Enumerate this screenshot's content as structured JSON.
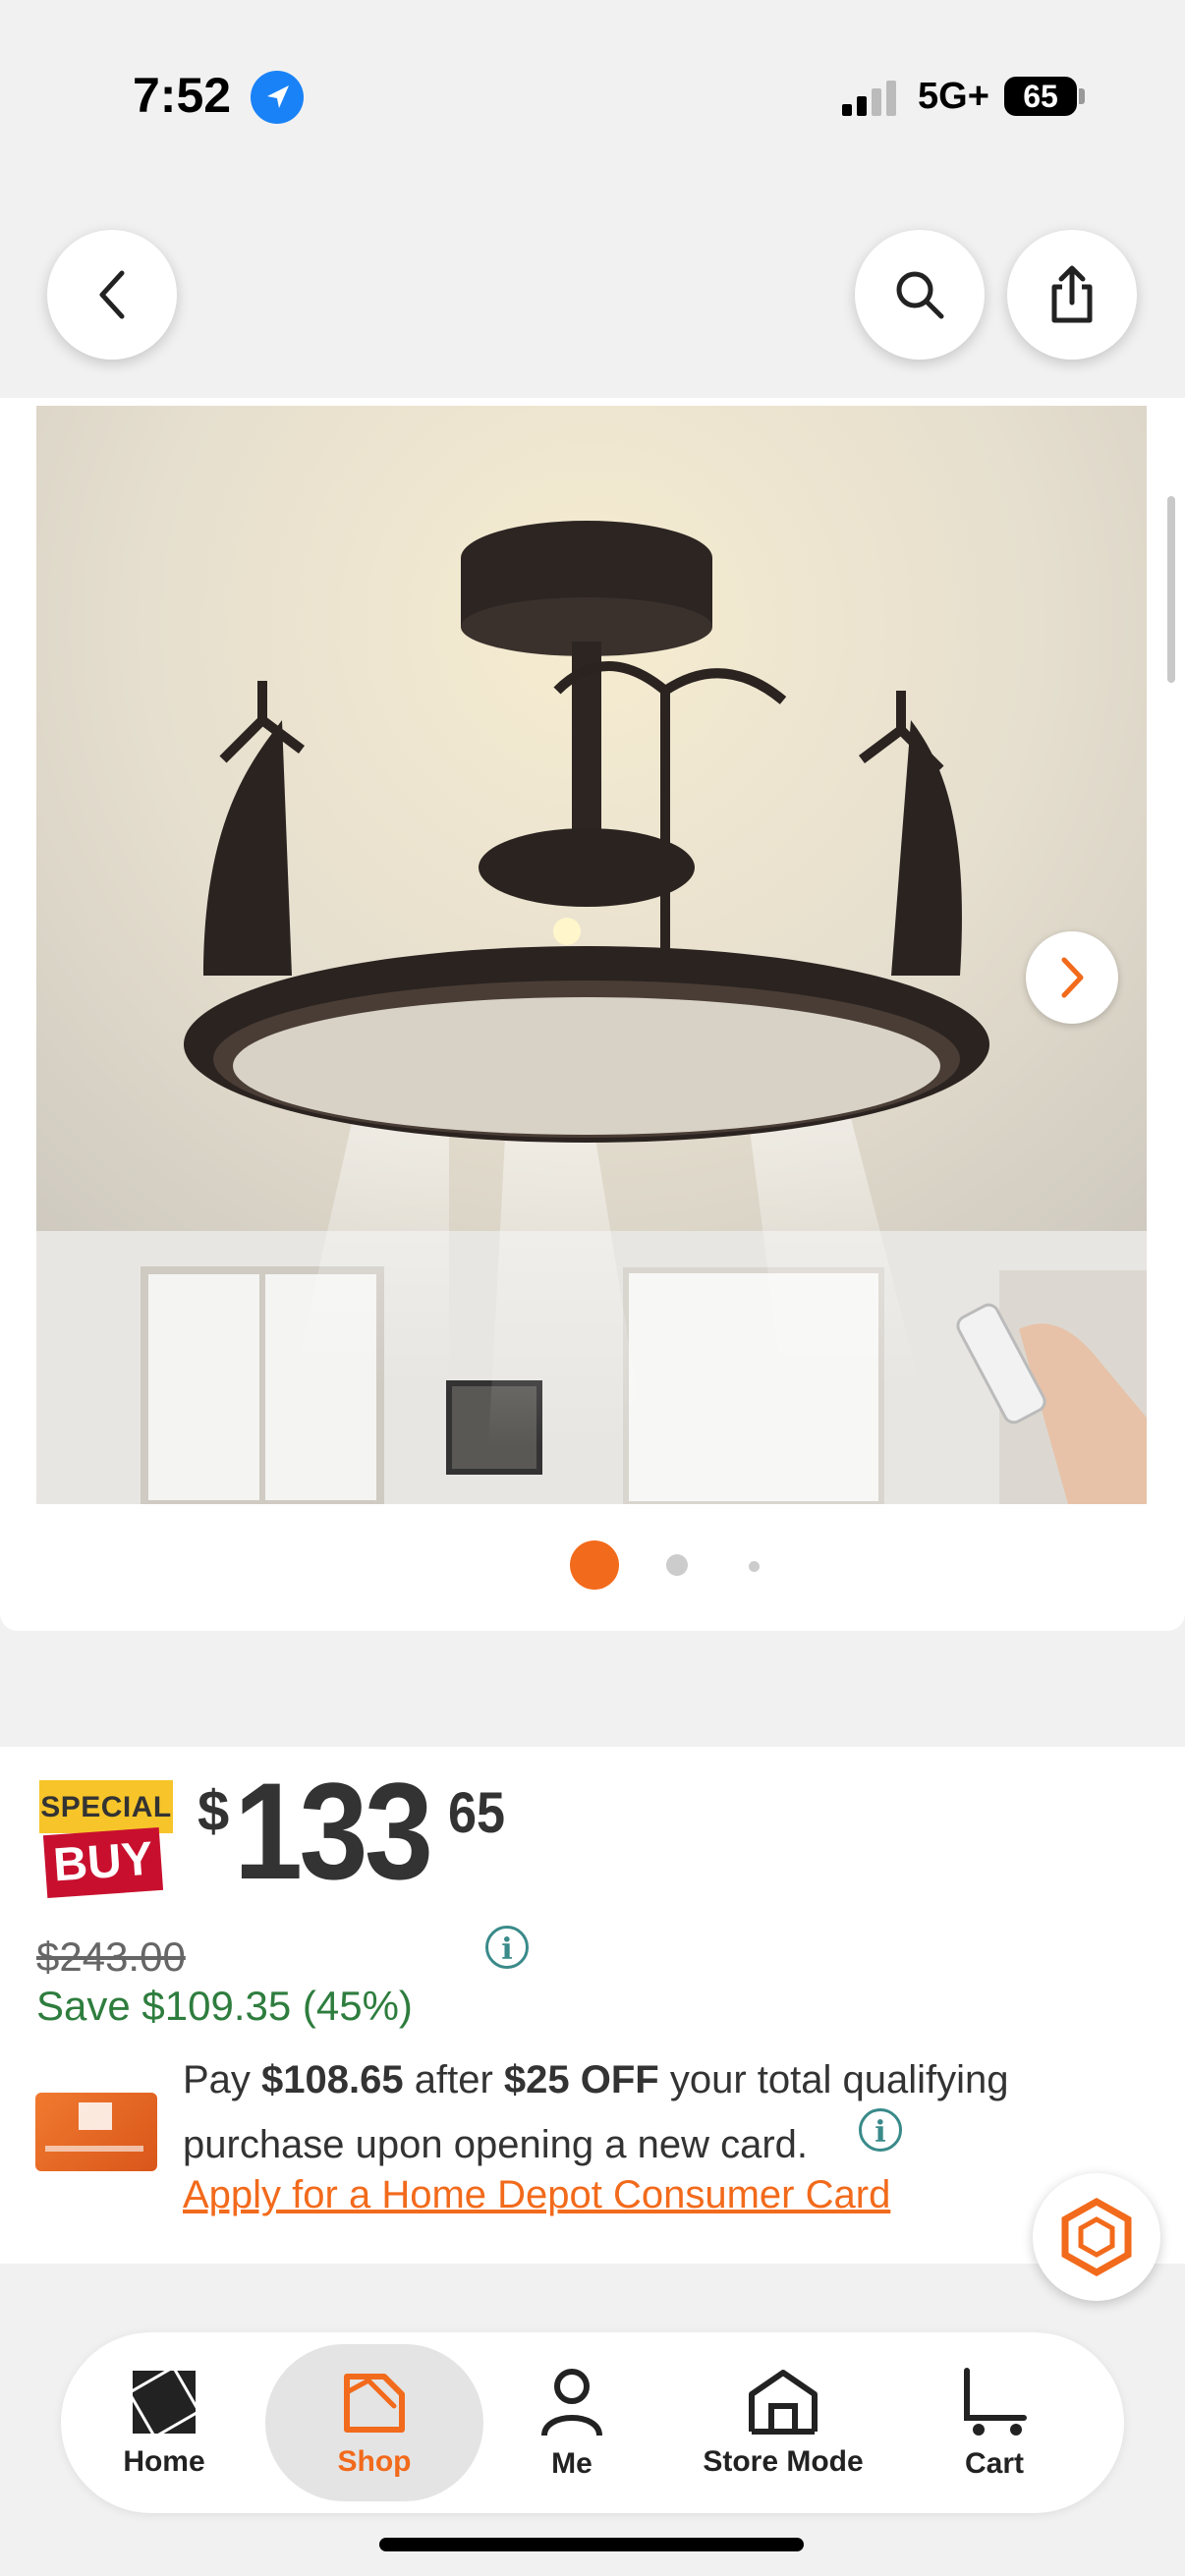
{
  "status_bar": {
    "time": "7:52",
    "network": "5G+",
    "battery": "65"
  },
  "product": {
    "badge": {
      "line1": "SPECIAL",
      "line2": "BUY"
    },
    "price": {
      "currency": "$",
      "dollars": "133",
      "cents": "65"
    },
    "was_price": "$243.00",
    "savings": "Save $109.35 (45%)",
    "card_offer": {
      "pay_prefix": "Pay ",
      "pay_amount": "$108.65",
      "pay_mid": " after ",
      "discount": "$25 OFF",
      "pay_suffix": " your total qualifying purchase upon opening a new card.",
      "apply_link": "Apply for a Home Depot Consumer Card"
    },
    "image_carousel": {
      "current": 1,
      "total": 3
    }
  },
  "bottom_nav": [
    {
      "label": "Home",
      "icon": "home-depot-logo-icon"
    },
    {
      "label": "Shop",
      "icon": "shop-tag-icon",
      "active": true
    },
    {
      "label": "Me",
      "icon": "person-icon"
    },
    {
      "label": "Store Mode",
      "icon": "store-icon"
    },
    {
      "label": "Cart",
      "icon": "cart-icon"
    }
  ],
  "colors": {
    "accent": "#f26a1b",
    "savings_green": "#2e7d3e",
    "sale_red": "#c8102e"
  }
}
